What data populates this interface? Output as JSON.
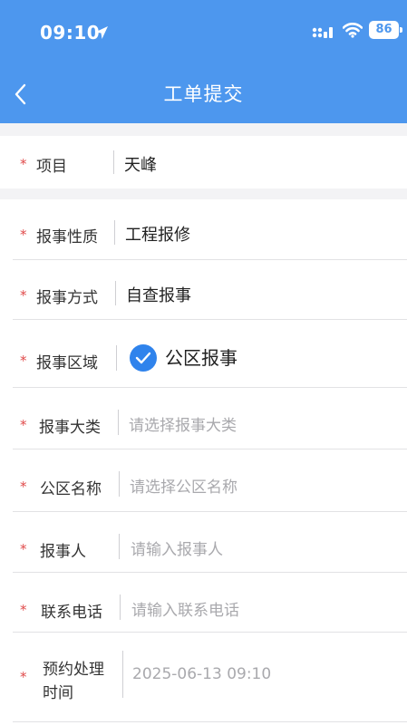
{
  "status_bar": {
    "time": "09:10",
    "battery": "86"
  },
  "header": {
    "title": "工单提交"
  },
  "form": {
    "required_mark": "*",
    "project": {
      "label": "项目",
      "value": "天峰"
    },
    "nature": {
      "label": "报事性质",
      "value": "工程报修"
    },
    "method": {
      "label": "报事方式",
      "value": "自查报事"
    },
    "area": {
      "label": "报事区域",
      "value": "公区报事"
    },
    "category": {
      "label": "报事大类",
      "placeholder": "请选择报事大类"
    },
    "public_area": {
      "label": "公区名称",
      "placeholder": "请选择公区名称"
    },
    "reporter": {
      "label": "报事人",
      "placeholder": "请输入报事人"
    },
    "phone": {
      "label": "联系电话",
      "placeholder": "请输入联系电话"
    },
    "appointment": {
      "label_line1": "预约处理",
      "label_line2": "时间",
      "value": "2025-06-13 09:10"
    }
  }
}
